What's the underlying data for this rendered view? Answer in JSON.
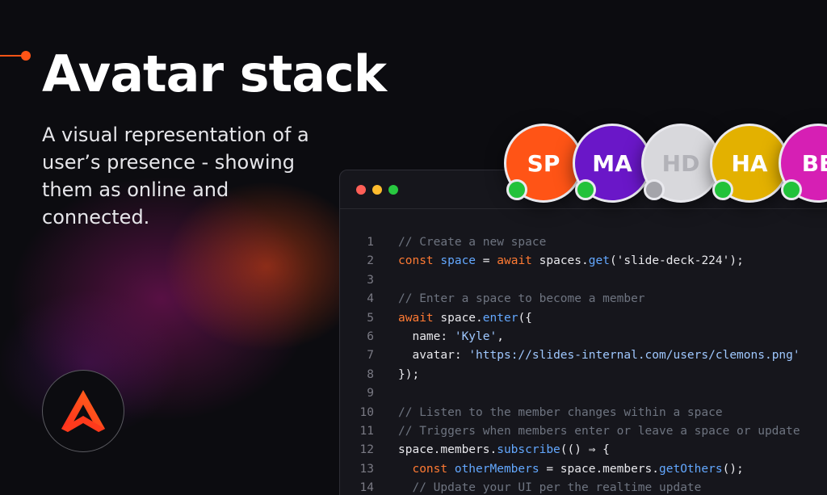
{
  "hero": {
    "title": "Avatar stack",
    "subtitle": "A visual representation of a user’s presence - showing them as online and connected."
  },
  "colors": {
    "accent": "#ff5416",
    "online": "#22c23a",
    "offline": "#a4a4aa"
  },
  "logo": {
    "icon": "ably-logo-icon"
  },
  "avatars": [
    {
      "initials": "SP",
      "color": "#ff5416",
      "text_color": "#ffffff",
      "status": "online"
    },
    {
      "initials": "MA",
      "color": "#6a17c8",
      "text_color": "#ffffff",
      "status": "online"
    },
    {
      "initials": "HD",
      "color": "#d8d8dc",
      "text_color": "#b2b2b8",
      "status": "offline"
    },
    {
      "initials": "HA",
      "color": "#e3b100",
      "text_color": "#ffffff",
      "status": "online"
    },
    {
      "initials": "BE",
      "color": "#d61fb4",
      "text_color": "#ffffff",
      "status": "online"
    }
  ],
  "code_window": {
    "controls": [
      "close",
      "minimize",
      "maximize"
    ],
    "lines": [
      {
        "num": "1",
        "tokens": [
          {
            "t": "// Create a new space",
            "k": "comment"
          }
        ]
      },
      {
        "num": "2",
        "tokens": [
          {
            "t": "const ",
            "k": "kw"
          },
          {
            "t": "space",
            "k": "var"
          },
          {
            "t": " = ",
            "k": "plain"
          },
          {
            "t": "await ",
            "k": "kw"
          },
          {
            "t": "spaces.",
            "k": "plain"
          },
          {
            "t": "get",
            "k": "fn"
          },
          {
            "t": "('slide-deck-224');",
            "k": "plain"
          }
        ]
      },
      {
        "num": "3",
        "tokens": []
      },
      {
        "num": "4",
        "tokens": [
          {
            "t": "// Enter a space to become a member",
            "k": "comment"
          }
        ]
      },
      {
        "num": "5",
        "tokens": [
          {
            "t": "await ",
            "k": "kw"
          },
          {
            "t": "space.",
            "k": "plain"
          },
          {
            "t": "enter",
            "k": "fn"
          },
          {
            "t": "({",
            "k": "plain"
          }
        ]
      },
      {
        "num": "6",
        "tokens": [
          {
            "t": "  name: ",
            "k": "plain"
          },
          {
            "t": "'Kyle'",
            "k": "str"
          },
          {
            "t": ",",
            "k": "plain"
          }
        ]
      },
      {
        "num": "7",
        "tokens": [
          {
            "t": "  avatar: ",
            "k": "plain"
          },
          {
            "t": "'https://slides-internal.com/users/clemons.png'",
            "k": "str"
          }
        ]
      },
      {
        "num": "8",
        "tokens": [
          {
            "t": "});",
            "k": "plain"
          }
        ]
      },
      {
        "num": "9",
        "tokens": []
      },
      {
        "num": "10",
        "tokens": [
          {
            "t": "// Listen to the member changes within a space",
            "k": "comment"
          }
        ]
      },
      {
        "num": "11",
        "tokens": [
          {
            "t": "// Triggers when members enter or leave a space or update",
            "k": "comment"
          }
        ]
      },
      {
        "num": "12",
        "tokens": [
          {
            "t": "space.members.",
            "k": "plain"
          },
          {
            "t": "subscribe",
            "k": "fn"
          },
          {
            "t": "(() ⇒ {",
            "k": "plain"
          }
        ]
      },
      {
        "num": "13",
        "tokens": [
          {
            "t": "  const ",
            "k": "kw"
          },
          {
            "t": "otherMembers",
            "k": "var"
          },
          {
            "t": " = space.members.",
            "k": "plain"
          },
          {
            "t": "getOthers",
            "k": "fn"
          },
          {
            "t": "();",
            "k": "plain"
          }
        ]
      },
      {
        "num": "14",
        "tokens": [
          {
            "t": "  // Update your UI per the realtime update",
            "k": "comment"
          }
        ]
      }
    ]
  }
}
